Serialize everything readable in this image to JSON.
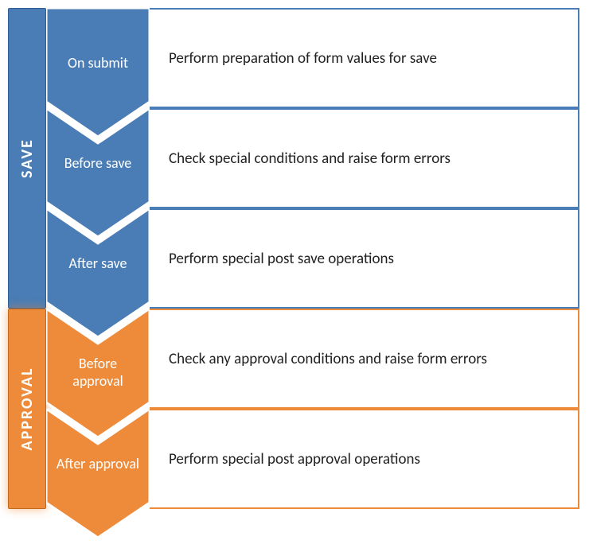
{
  "phases": {
    "save": {
      "label": "SAVE",
      "color": "#4A7DB5"
    },
    "approval": {
      "label": "APPROVAL",
      "color": "#ED8B3A"
    }
  },
  "steps": [
    {
      "phase": "save",
      "label": "On submit",
      "desc": "Perform preparation of form values for save"
    },
    {
      "phase": "save",
      "label": "Before save",
      "desc": "Check special conditions and raise form errors"
    },
    {
      "phase": "save",
      "label": "After save",
      "desc": "Perform special post save operations"
    },
    {
      "phase": "approval",
      "label": "Before approval",
      "desc": "Check any approval conditions and raise form errors"
    },
    {
      "phase": "approval",
      "label": "After approval",
      "desc": "Perform special post approval operations"
    }
  ]
}
